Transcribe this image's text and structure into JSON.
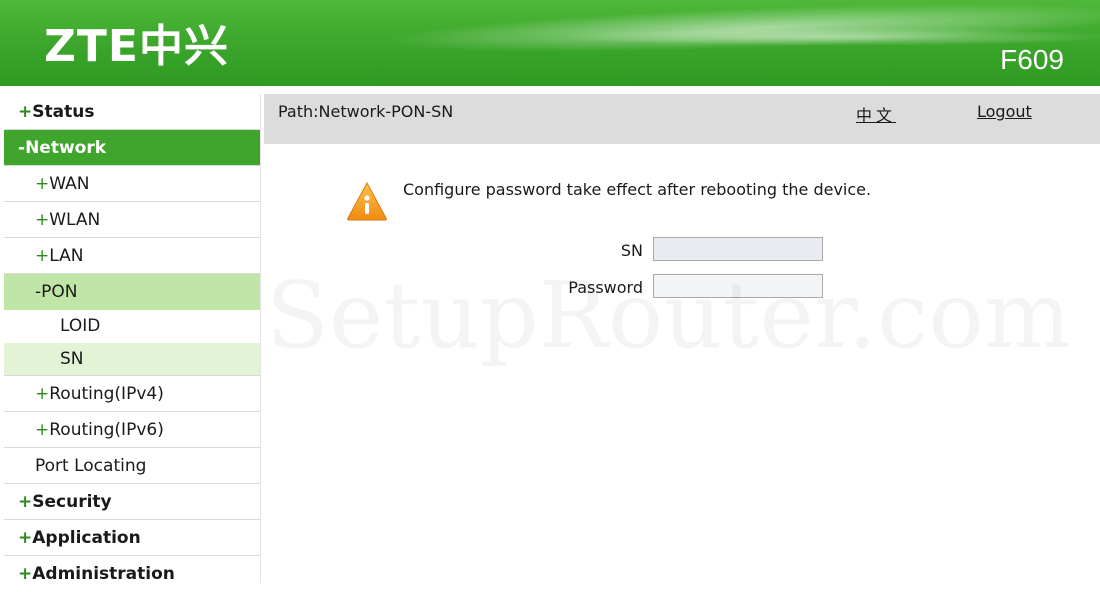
{
  "header": {
    "logo": "ZTE中兴",
    "model": "F609"
  },
  "sidebar": {
    "items": [
      {
        "sign": "+",
        "label": "Status"
      },
      {
        "sign": "-",
        "label": "Network"
      },
      {
        "sign": "+",
        "label": "WAN"
      },
      {
        "sign": "+",
        "label": "WLAN"
      },
      {
        "sign": "+",
        "label": "LAN"
      },
      {
        "sign": "-",
        "label": "PON"
      },
      {
        "label": "LOID"
      },
      {
        "label": "SN"
      },
      {
        "sign": "+",
        "label": "Routing(IPv4)"
      },
      {
        "sign": "+",
        "label": "Routing(IPv6)"
      },
      {
        "label": "Port Locating"
      },
      {
        "sign": "+",
        "label": "Security"
      },
      {
        "sign": "+",
        "label": "Application"
      },
      {
        "sign": "+",
        "label": "Administration"
      }
    ]
  },
  "pathbar": {
    "path": "Path:Network-PON-SN",
    "lang": "中文",
    "logout": "Logout"
  },
  "notice": {
    "text": "Configure password take effect after rebooting the device.",
    "icon": "warning-icon"
  },
  "form": {
    "sn_label": "SN",
    "sn_value": "",
    "password_label": "Password",
    "password_value": ""
  },
  "watermark": "SetupRouter.com",
  "colors": {
    "brand_green": "#3fa52c",
    "active_sub": "#bfe6a6",
    "active_leaf": "#e3f3d6",
    "warning_orange": "#f39a1e"
  }
}
